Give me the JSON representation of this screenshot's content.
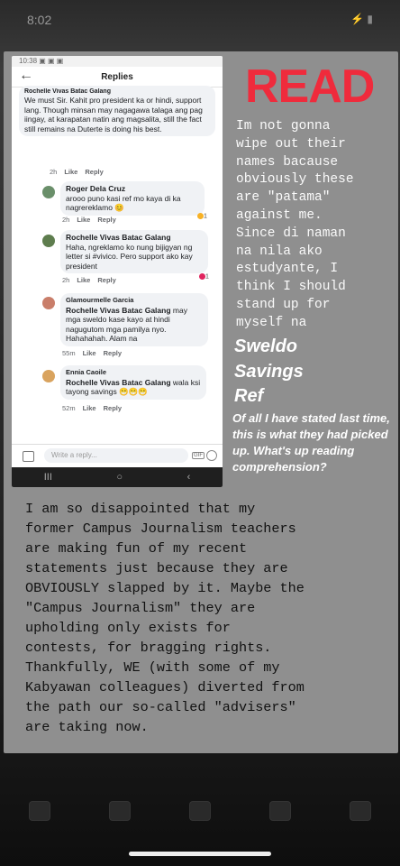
{
  "status": {
    "time": "8:02",
    "right": "⚡ ▮"
  },
  "phone": {
    "header_title": "Replies",
    "status_bar": "10:38 ▣ ▣ ▣",
    "comments": [
      {
        "name": "Rochelle Vivas Batac Galang",
        "text": "We must Sir. Kahit pro president ka or hindi, support lang. Though minsan may nagagawa talaga ang pag iingay, at karapatan natin ang magsalita, still the fact still remains na Duterte is doing his best.",
        "time": "2h",
        "like": "Like",
        "reply": "Reply"
      },
      {
        "name": "Roger Dela Cruz",
        "text": "arooo puno kasi ref mo kaya di ka nagrereklamo 😊",
        "time": "2h",
        "like": "Like",
        "reply": "Reply",
        "reaction": "1"
      },
      {
        "name": "Rochelle Vivas Batac Galang",
        "text": "Haha, ngreklamo ko nung bijigyan ng letter si #vivico. Pero support ako kay president",
        "time": "2h",
        "like": "Like",
        "reply": "Reply",
        "reaction": "1"
      },
      {
        "name": "Glamourmelle Garcia",
        "tag": "Rochelle Vivas Batac Galang",
        "text": "may mga sweldo kase kayo at hindi nagugutom mga pamilya nyo. Hahahahah. Alam na",
        "time": "55m",
        "like": "Like",
        "reply": "Reply"
      },
      {
        "name": "Ennia Caoile",
        "tag": "Rochelle Vivas Batac Galang",
        "text": "wala ksi tayong savings 😁😁😁",
        "time": "52m",
        "like": "Like",
        "reply": "Reply"
      }
    ],
    "input_placeholder": "Write a reply...",
    "gif": "GIF",
    "nav": {
      "back": "‹",
      "home": "○",
      "recents": "III"
    }
  },
  "story": {
    "read": "READ",
    "right_text": "Im not gonna\nwipe out their\nnames bacause\nobviously these\nare \"patama\"\nagainst me.\nSince di naman\nna nila ako\nestudyante, I\nthink I should\nstand up for\nmyself na",
    "word1": "Sweldo",
    "word2": "Savings",
    "word3": "Ref",
    "italic_note": "Of all I have stated last time, this is what they had picked up. What's up reading comprehension?",
    "bottom_text": "I am so disappointed that my\nformer Campus Journalism teachers\nare making fun of my recent\nstatements just because they are\nOBVIOUSLY slapped by it. Maybe the\n\"Campus Journalism\" they are\nupholding only exists for\ncontests, for bragging rights.\nThankfully, WE (with some of my\nKabyawan colleagues) diverted from\nthe path our so-called \"advisers\"\nare taking now."
  },
  "colors": {
    "read_red": "#ef2b3c",
    "card_gray": "#8f8f8f"
  },
  "icons": [
    "back-arrow-icon",
    "camera-icon",
    "gif-icon",
    "emoji-icon",
    "home-icon",
    "search-icon",
    "watch-icon",
    "bell-icon",
    "menu-icon"
  ]
}
